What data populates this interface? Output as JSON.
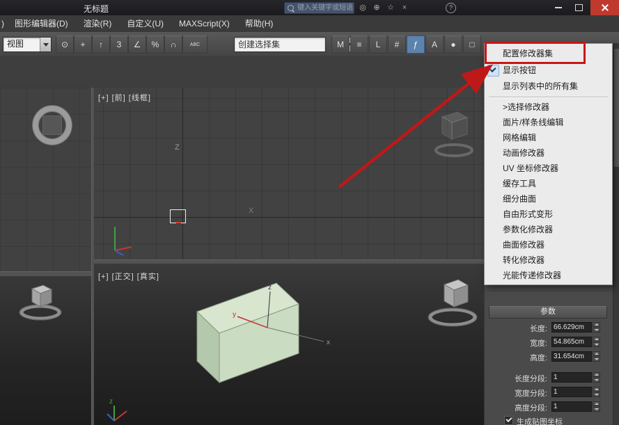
{
  "titlebar": {
    "title": "无标题",
    "search_placeholder": "键入关键字或短语",
    "icons": [
      {
        "name": "search-config-icon",
        "glyph": "◎"
      },
      {
        "name": "zoom-search-icon",
        "glyph": "⊕"
      },
      {
        "name": "favorites-icon",
        "glyph": "☆"
      },
      {
        "name": "clear-search-icon",
        "glyph": "×"
      },
      {
        "name": "help-icon",
        "glyph": "?"
      }
    ]
  },
  "menubar": {
    "partial": ")",
    "items": [
      "图形编辑器(D)",
      "渲染(R)",
      "自定义(U)",
      "MAXScript(X)",
      "帮助(H)"
    ]
  },
  "toolbar": {
    "coord_dropdown": "视图",
    "selection_set": "创建选择集",
    "icons_left": [
      {
        "name": "use-pivot-center-icon",
        "glyph": "⊙"
      },
      {
        "name": "select-manipulate-icon",
        "glyph": "+"
      },
      {
        "name": "select-place-icon",
        "glyph": "↑"
      },
      {
        "name": "snap-toggle-3d-icon",
        "glyph": "3"
      },
      {
        "name": "angle-snap-icon",
        "glyph": "∠"
      },
      {
        "name": "percent-snap-icon",
        "glyph": "%"
      },
      {
        "name": "spinner-snap-icon",
        "glyph": "∩"
      },
      {
        "name": "edit-named-selections-icon",
        "glyph": "ABC"
      }
    ],
    "icons_right": [
      {
        "name": "mirror-icon",
        "glyph": "M"
      },
      {
        "name": "align-icon",
        "glyph": "≡"
      },
      {
        "name": "layer-manager-icon",
        "glyph": "L"
      },
      {
        "name": "scene-explorer-icon",
        "glyph": "#"
      },
      {
        "name": "curve-editor-icon",
        "glyph": "ƒ"
      },
      {
        "name": "schematic-view-icon",
        "glyph": "A"
      },
      {
        "name": "material-editor-icon",
        "glyph": "●"
      },
      {
        "name": "render-setup-icon",
        "glyph": "□"
      }
    ]
  },
  "context_menu": {
    "items": [
      {
        "label": "配置修改器集"
      },
      {
        "label": "显示按钮",
        "checked": true
      },
      {
        "label": "显示列表中的所有集"
      },
      {
        "label": ">选择修改器"
      },
      {
        "label": "面片/样条线编辑"
      },
      {
        "label": "网格编辑"
      },
      {
        "label": "动画修改器"
      },
      {
        "label": "UV 坐标修改器"
      },
      {
        "label": "缓存工具"
      },
      {
        "label": "细分曲面"
      },
      {
        "label": "自由形式变形"
      },
      {
        "label": "参数化修改器"
      },
      {
        "label": "曲面修改器"
      },
      {
        "label": "转化修改器"
      },
      {
        "label": "光能传递修改器"
      }
    ]
  },
  "viewports": {
    "front": {
      "label": "[+] [前] [线框]",
      "axis_z": "Z",
      "axis_x": "X"
    },
    "ortho": {
      "label": "[+] [正交] [真实]",
      "axis_z": "z",
      "axis_y": "y",
      "axis_x": "x"
    }
  },
  "params": {
    "header": "参数",
    "fields": [
      {
        "label": "长度:",
        "value": "66.629cm"
      },
      {
        "label": "宽度:",
        "value": "54.865cm"
      },
      {
        "label": "高度:",
        "value": "31.654cm"
      },
      {
        "label": "长度分段:",
        "value": "1"
      },
      {
        "label": "宽度分段:",
        "value": "1"
      },
      {
        "label": "高度分段:",
        "value": "1"
      }
    ],
    "checkbox": "生成贴图坐标"
  },
  "colors": {
    "annotation_red": "#c81616",
    "selected_tile_blue": "#5d83ad",
    "box_top": "#d8e6d0",
    "box_front": "#cadcc2",
    "box_side": "#b4c8ac",
    "close_button": "#c0392e"
  }
}
